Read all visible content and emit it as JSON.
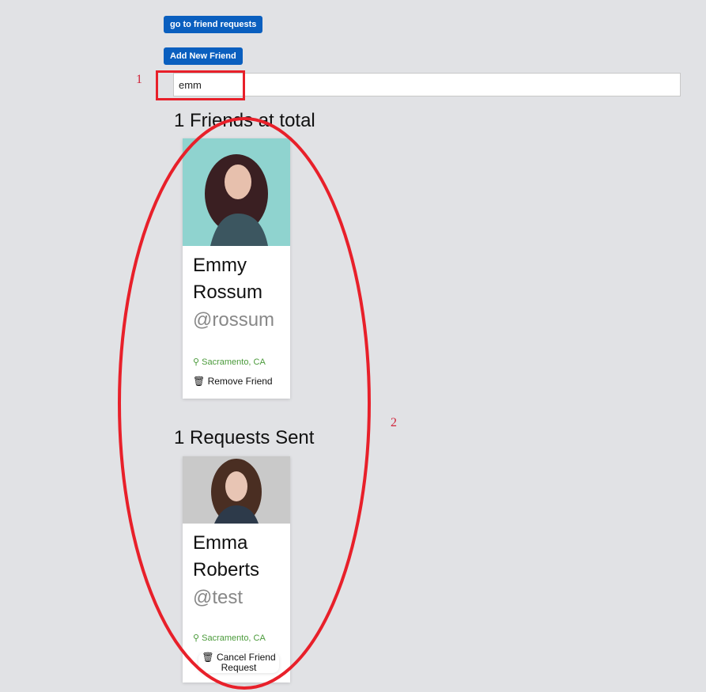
{
  "header": {
    "friend_requests_button": "go to friend requests",
    "add_friend_button": "Add New Friend"
  },
  "search": {
    "value": "emm"
  },
  "friends": {
    "heading": "1 Friends at total",
    "items": [
      {
        "first": "Emmy",
        "last": "Rossum",
        "handle": "@rossum",
        "location": "Sacramento, CA",
        "action": "Remove Friend"
      }
    ]
  },
  "requests": {
    "heading": "1 Requests Sent",
    "items": [
      {
        "first": "Emma",
        "last": "Roberts",
        "handle": "@test",
        "location": "Sacramento, CA",
        "action_line1": "Cancel Friend",
        "action_line2": "Request"
      }
    ]
  },
  "annotations": {
    "label1": "1",
    "label2": "2",
    "color": "#e8202a"
  }
}
